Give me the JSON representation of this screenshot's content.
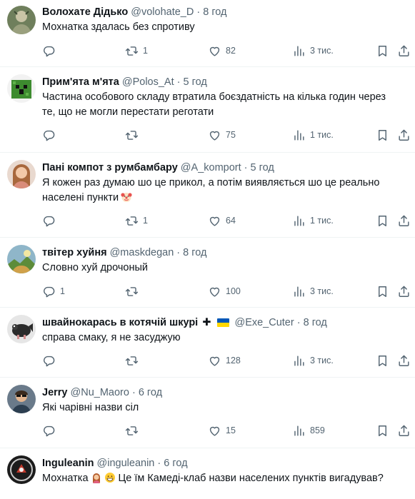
{
  "tweets": [
    {
      "name": "Волохате Дідько",
      "handle": "@volohate_D",
      "dot": "·",
      "time": "8 год",
      "lines": [
        "Мохнатка здалась без спротиву"
      ],
      "replies": "",
      "retweets": "1",
      "likes": "82",
      "views": "3 тис."
    },
    {
      "name": "Прим'ята м'ята",
      "handle": "@Polos_At",
      "dot": "·",
      "time": "5 год",
      "lines": [
        "Частина особового складу втратила боєздатність на кілька годин через",
        "те, що не могли перестати реготати"
      ],
      "replies": "",
      "retweets": "",
      "likes": "75",
      "views": "1 тис."
    },
    {
      "name": "Пані компот з румбамбару",
      "handle": "@A_komport",
      "dot": "·",
      "time": "5 год",
      "lines": [
        "Я кожен раз думаю шо це прикол, а потім виявляється шо це реально",
        "населені пункти"
      ],
      "replies": "",
      "retweets": "1",
      "likes": "64",
      "views": "1 тис."
    },
    {
      "name": "твітер хуйня",
      "handle": "@maskdegan",
      "dot": "·",
      "time": "8 год",
      "lines": [
        "Словно хуй дрочоный"
      ],
      "replies": "1",
      "retweets": "",
      "likes": "100",
      "views": "3 тис."
    },
    {
      "name": "швайнокарась в котячій шкурі",
      "handle": "@Exe_Cuter",
      "dot": "·",
      "time": "8 год",
      "lines": [
        "справа смаку, я не засуджую"
      ],
      "replies": "",
      "retweets": "",
      "likes": "128",
      "views": "3 тис."
    },
    {
      "name": "Jerry",
      "handle": "@Nu_Maoro",
      "dot": "·",
      "time": "6 год",
      "lines": [
        "Які чарівні назви сіл"
      ],
      "replies": "",
      "retweets": "",
      "likes": "15",
      "views": "859"
    },
    {
      "name": "Inguleanin",
      "handle": "@inguleanin",
      "dot": "·",
      "time": "6 год",
      "lines": [
        "Мохнатка",
        "Це їм Камеді-клаб назви населених пунктів вигадував?"
      ],
      "replies": "",
      "retweets": "",
      "likes": "",
      "views": ""
    }
  ],
  "extras": {
    "cross_glyph": "✚",
    "icons": {
      "reply": "reply-icon",
      "retweet": "retweet-icon",
      "like": "heart-icon",
      "views": "views-chart-icon",
      "bookmark": "bookmark-icon",
      "share": "share-icon",
      "clown": "clown-emoji-icon",
      "woman": "woman-emoji-icon",
      "grin": "grin-emoji-icon",
      "flag": "ukraine-flag-icon"
    },
    "colors": {
      "text": "#0f1419",
      "secondary": "#536471",
      "divider": "#eff3f4",
      "flag_blue": "#0057b7",
      "flag_yellow": "#ffd700"
    }
  }
}
